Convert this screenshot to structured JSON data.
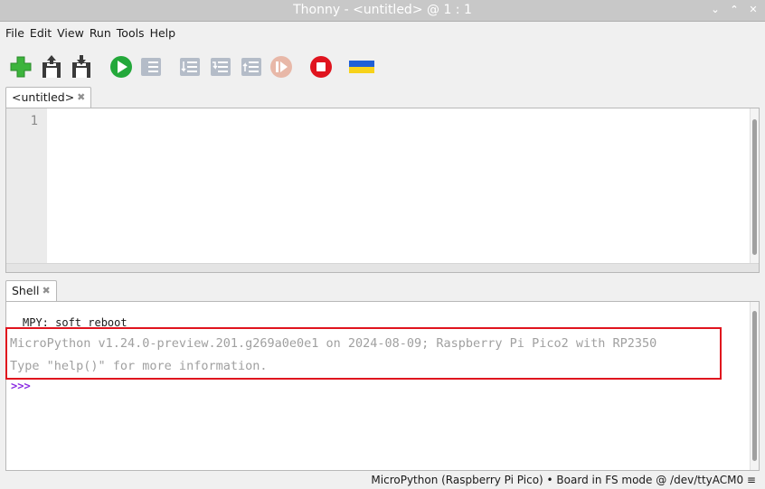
{
  "window": {
    "title": "Thonny  -  <untitled>  @  1 : 1"
  },
  "window_buttons": [
    "⌄",
    "⌃",
    "✕"
  ],
  "menu": [
    "File",
    "Edit",
    "View",
    "Run",
    "Tools",
    "Help"
  ],
  "toolbar": {
    "icons": [
      "new-file-icon",
      "open-file-icon",
      "save-file-icon",
      "run-icon",
      "debug-icon",
      "step-over-icon",
      "step-into-icon",
      "step-out-icon",
      "resume-icon",
      "stop-icon",
      "ukraine-flag-icon"
    ],
    "colors": {
      "new": "#3cb43c",
      "run": "#23a83a",
      "stop": "#e0141e",
      "flag_blue": "#1f5fd6",
      "flag_yellow": "#f7d21a",
      "disabled": "#b4bcc8"
    }
  },
  "editor": {
    "tab_label": "<untitled>",
    "tab_close": "✖",
    "line_numbers": [
      "1"
    ]
  },
  "shell": {
    "tab_label": "Shell",
    "tab_close": "✖",
    "lines": [
      "MPY: soft reboot",
      "MicroPython v1.24.0-preview.201.g269a0e0e1 on 2024-08-09; Raspberry Pi Pico2 with RP2350",
      "Type \"help()\" for more information.",
      ">>>"
    ]
  },
  "status": {
    "text": "MicroPython (Raspberry Pi Pico)  •  Board in FS mode @ /dev/ttyACM0  ≡"
  },
  "highlight_color": "#e0141e"
}
